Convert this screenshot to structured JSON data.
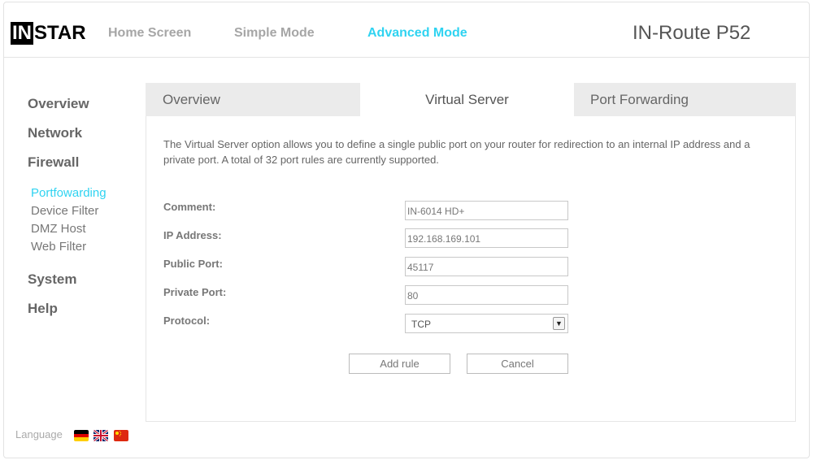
{
  "header": {
    "logo_boxed": "IN",
    "logo_rest": "STAR",
    "nav": [
      "Home Screen",
      "Simple Mode",
      "Advanced Mode"
    ],
    "product": "IN-Route P52",
    "accent_color": "#2fd3f1"
  },
  "sidebar": {
    "items": [
      "Overview",
      "Network",
      "Firewall",
      "System",
      "Help"
    ],
    "firewall_sub": [
      "Portfowarding",
      "Device Filter",
      "DMZ Host",
      "Web Filter"
    ],
    "active_sub": "Portfowarding"
  },
  "language": {
    "label": "Language",
    "flags": [
      "german-flag-icon",
      "uk-flag-icon",
      "china-flag-icon"
    ]
  },
  "tabs": [
    "Overview",
    "Virtual Server",
    "Port Forwarding"
  ],
  "active_tab": "Virtual Server",
  "description": "The Virtual Server option allows you to define a single public port on your router for redirection to an internal IP address and a private port. A total of 32 port rules are currently supported.",
  "form": {
    "comment_label": "Comment:",
    "comment_value": "IN-6014 HD+",
    "ip_label": "IP Address:",
    "ip_value": "192.168.169.101",
    "public_port_label": "Public Port:",
    "public_port_value": "45117",
    "private_port_label": "Private Port:",
    "private_port_value": "80",
    "protocol_label": "Protocol:",
    "protocol_value": "TCP"
  },
  "buttons": {
    "add": "Add rule",
    "cancel": "Cancel"
  }
}
